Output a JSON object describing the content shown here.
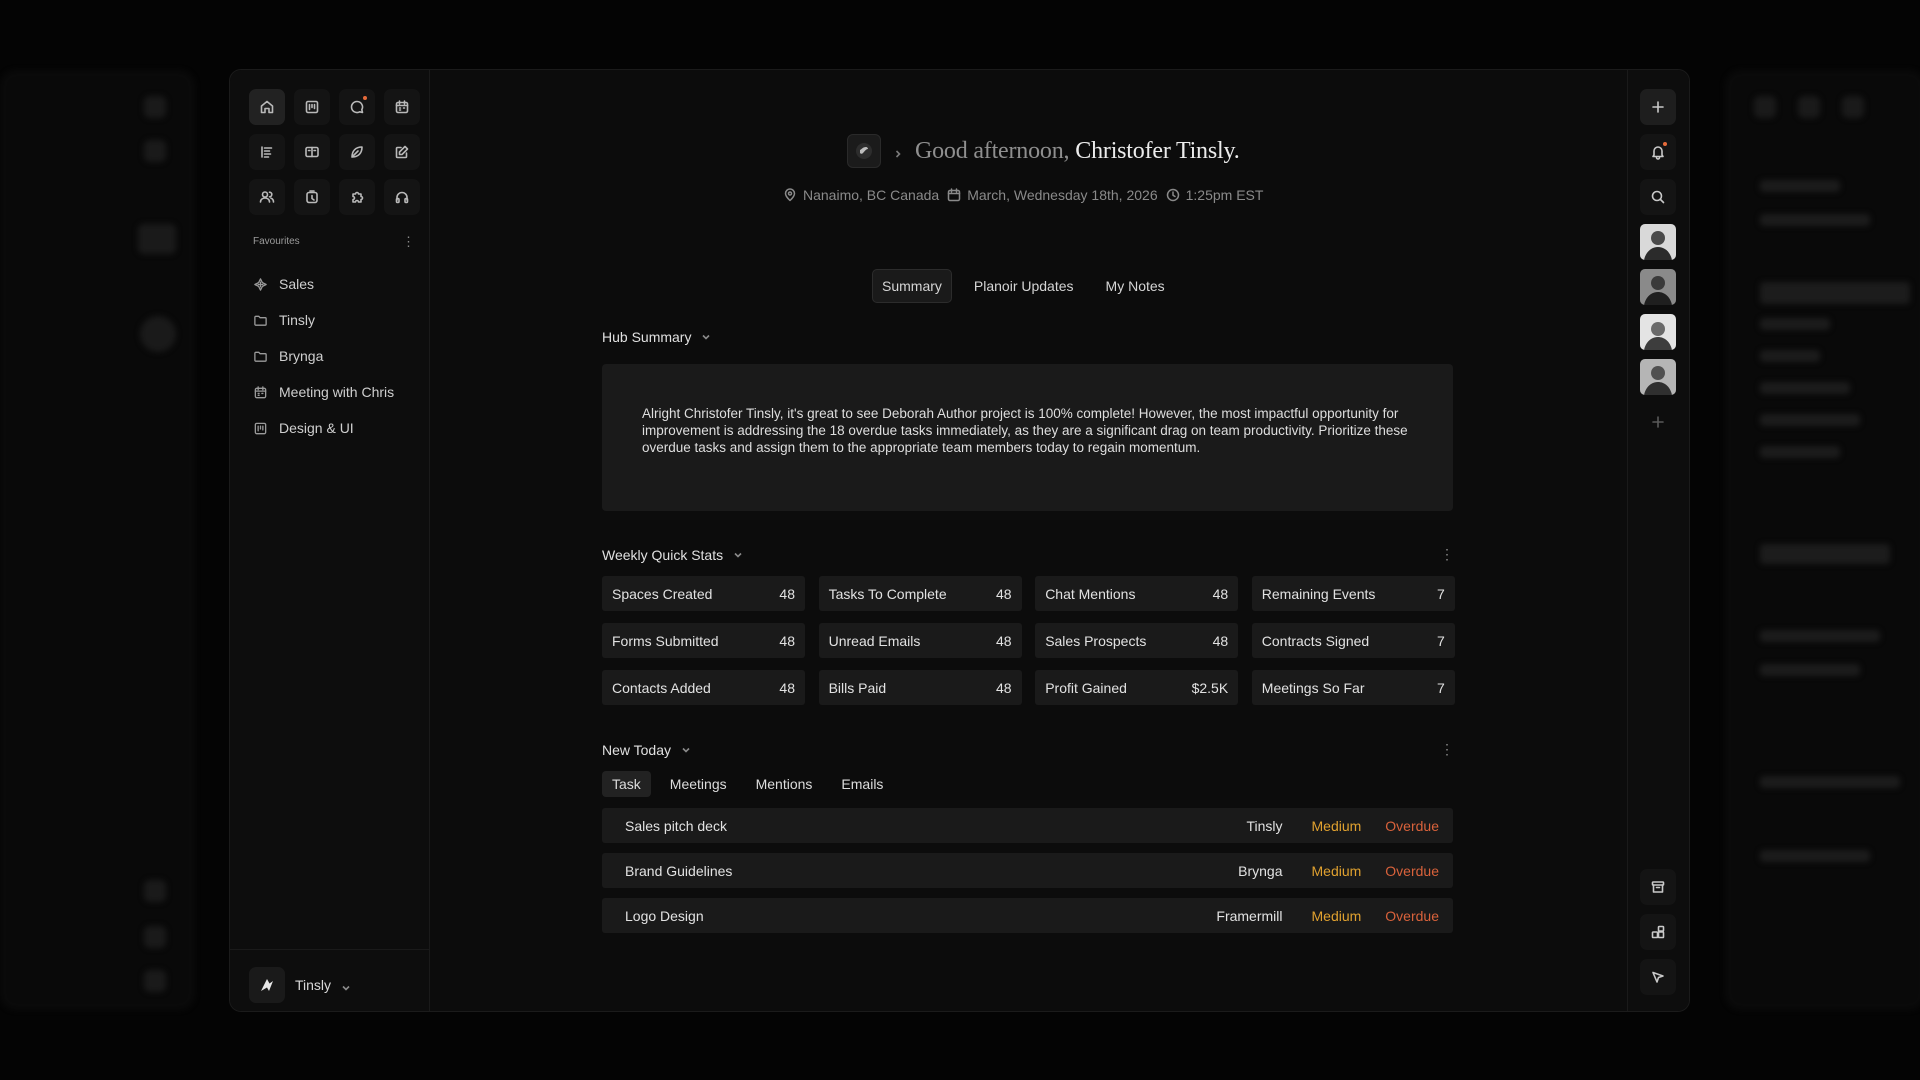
{
  "header": {
    "greeting": "Good afternoon,",
    "user_name": "Christofer Tinsly.",
    "location": "Nanaimo, BC Canada",
    "date": "March, Wednesday 18th, 2026",
    "time": "1:25pm EST"
  },
  "tabs": [
    {
      "label": "Summary",
      "active": true
    },
    {
      "label": "Planoir Updates",
      "active": false
    },
    {
      "label": "My Notes",
      "active": false
    }
  ],
  "sidebar": {
    "icons": [
      "home-icon",
      "layout-icon",
      "chat-icon",
      "calendar-icon",
      "list-icon",
      "book-icon",
      "leaf-icon",
      "edit-icon",
      "users-icon",
      "timer-icon",
      "puzzle-icon",
      "headphones-icon"
    ],
    "favourites_title": "Favourites",
    "favourites": [
      {
        "label": "Sales",
        "icon": "sparkle-icon"
      },
      {
        "label": "Tinsly",
        "icon": "folder-icon"
      },
      {
        "label": "Brynga",
        "icon": "folder-icon"
      },
      {
        "label": "Meeting with Chris",
        "icon": "calendar-icon"
      },
      {
        "label": "Design & UI",
        "icon": "layout-icon"
      }
    ],
    "workspace": "Tinsly"
  },
  "hub_summary": {
    "title": "Hub Summary",
    "text": "Alright Christofer Tinsly, it's great to see Deborah Author project is 100% complete! However, the most impactful opportunity for improvement is addressing the 18 overdue tasks immediately, as they are a significant drag on team productivity. Prioritize these overdue tasks and assign them to the appropriate team members today to regain momentum."
  },
  "weekly_stats": {
    "title": "Weekly Quick Stats",
    "items": [
      {
        "label": "Spaces Created",
        "value": "48"
      },
      {
        "label": "Tasks To Complete",
        "value": "48"
      },
      {
        "label": "Chat Mentions",
        "value": "48"
      },
      {
        "label": "Remaining Events",
        "value": "7"
      },
      {
        "label": "Forms Submitted",
        "value": "48"
      },
      {
        "label": "Unread Emails",
        "value": "48"
      },
      {
        "label": "Sales Prospects",
        "value": "48"
      },
      {
        "label": "Contracts Signed",
        "value": "7"
      },
      {
        "label": "Contacts Added",
        "value": "48"
      },
      {
        "label": "Bills Paid",
        "value": "48"
      },
      {
        "label": "Profit Gained",
        "value": "$2.5K"
      },
      {
        "label": "Meetings So Far",
        "value": "7"
      }
    ]
  },
  "new_today": {
    "title": "New Today",
    "tabs": [
      {
        "label": "Task",
        "active": true
      },
      {
        "label": "Meetings",
        "active": false
      },
      {
        "label": "Mentions",
        "active": false
      },
      {
        "label": "Emails",
        "active": false
      }
    ],
    "rows": [
      {
        "title": "Sales pitch deck",
        "owner": "Tinsly",
        "priority": "Medium",
        "status": "Overdue"
      },
      {
        "title": "Brand Guidelines",
        "owner": "Brynga",
        "priority": "Medium",
        "status": "Overdue"
      },
      {
        "title": "Logo Design",
        "owner": "Framermill",
        "priority": "Medium",
        "status": "Overdue"
      }
    ]
  },
  "colors": {
    "priority_medium": "#e0a12f",
    "status_overdue": "#d9623b",
    "notification_dot": "#e56a3a"
  }
}
